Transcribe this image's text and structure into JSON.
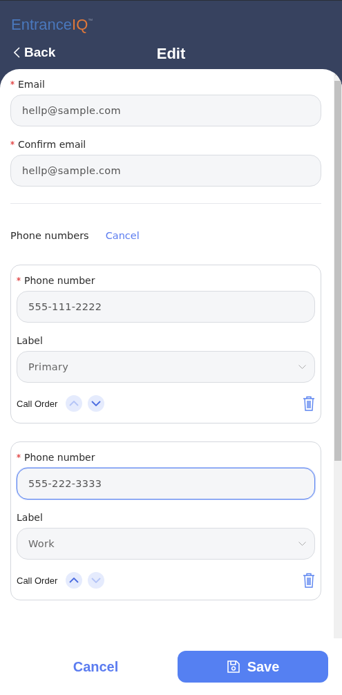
{
  "logo": {
    "main": "Entrance",
    "accent": "IQ",
    "mark": "™"
  },
  "header": {
    "back": "Back",
    "title": "Edit"
  },
  "email_fields": [
    {
      "label": "Email",
      "required": true,
      "value": "hellp@sample.com"
    },
    {
      "label": "Confirm email",
      "required": true,
      "value": "hellp@sample.com"
    }
  ],
  "phones": {
    "title": "Phone numbers",
    "cancel": "Cancel",
    "entries": [
      {
        "number_label": "Phone number",
        "required": true,
        "value": "555-111-2222",
        "focused": false,
        "label_label": "Label",
        "label_value": "Primary",
        "call_order": "Call Order",
        "up_disabled": true,
        "down_disabled": false
      },
      {
        "number_label": "Phone number",
        "required": true,
        "value": "555-222-3333",
        "focused": true,
        "label_label": "Label",
        "label_value": "Work",
        "call_order": "Call Order",
        "up_disabled": false,
        "down_disabled": true
      }
    ]
  },
  "footer": {
    "cancel": "Cancel",
    "save": "Save"
  }
}
